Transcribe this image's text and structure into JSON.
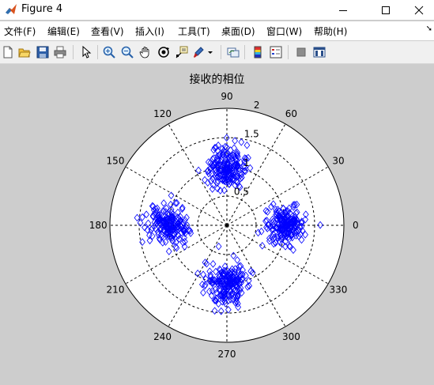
{
  "window": {
    "title": "Figure 4"
  },
  "menu": [
    "文件(F)",
    "编辑(E)",
    "查看(V)",
    "插入(I)",
    "工具(T)",
    "桌面(D)",
    "窗口(W)",
    "帮助(H)"
  ],
  "toolbar": {
    "buttons": [
      "new-figure-icon",
      "open-file-icon",
      "save-icon",
      "print-icon",
      "edit-plot-arrow-icon",
      "zoom-in-icon",
      "zoom-out-icon",
      "pan-hand-icon",
      "rotate-3d-icon",
      "data-cursor-icon",
      "brush-icon",
      "link-plot-icon",
      "colorbar-icon",
      "legend-icon",
      "hide-plot-tools-icon",
      "show-plot-tools-icon"
    ]
  },
  "chart_data": {
    "type": "scatter",
    "title": "接收的相位",
    "coordinate_system": "polar",
    "marker": "diamond",
    "color": "#0000ff",
    "radial_ticks": [
      "0.5",
      "1",
      "1.5",
      "2"
    ],
    "radial_max": 2,
    "angle_ticks": [
      "0",
      "30",
      "60",
      "90",
      "120",
      "150",
      "180",
      "210",
      "240",
      "270",
      "300",
      "330"
    ],
    "grid": true,
    "clusters": [
      {
        "angle_deg": 0,
        "radius": 1.0,
        "approx_points": 200,
        "spread": 0.17
      },
      {
        "angle_deg": 90,
        "radius": 1.0,
        "approx_points": 200,
        "spread": 0.17
      },
      {
        "angle_deg": 180,
        "radius": 1.0,
        "approx_points": 200,
        "spread": 0.17
      },
      {
        "angle_deg": 270,
        "radius": 1.0,
        "approx_points": 200,
        "spread": 0.17
      }
    ]
  }
}
